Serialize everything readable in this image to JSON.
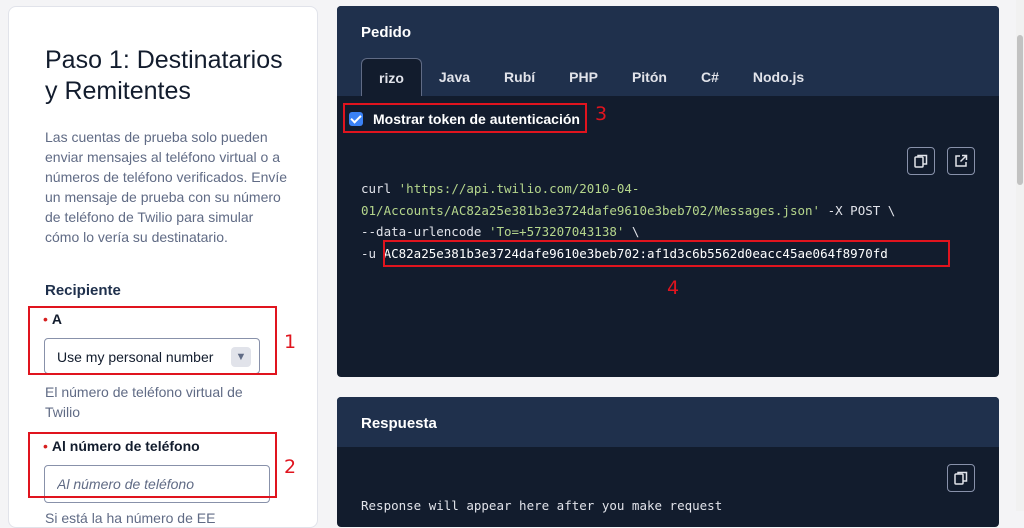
{
  "left": {
    "title": "Paso 1: Destinatarios y Remitentes",
    "description": "Las cuentas de prueba solo pueden enviar mensajes al teléfono virtual o a números de teléfono verificados. Envíe un mensaje de prueba con su número de teléfono de Twilio para simular cómo lo vería su destinatario.",
    "section_heading": "Recipiente",
    "to_field": {
      "required_mark": "•",
      "label": "A",
      "selected": "Use my personal number",
      "helper": "El número de teléfono virtual de Twilio"
    },
    "phone_field": {
      "required_mark": "•",
      "label": "Al número de teléfono",
      "placeholder": "Al número de teléfono",
      "cut_text": "Si está la ha número de EE"
    }
  },
  "annotations": [
    "1",
    "2",
    "3",
    "4"
  ],
  "request": {
    "title": "Pedido",
    "tabs": [
      "rizo",
      "Java",
      "Rubí",
      "PHP",
      "Pitón",
      "C#",
      "Nodo.js"
    ],
    "active_tab": "rizo",
    "show_token_label": "Mostrar token de autenticación",
    "show_token_checked": true,
    "code": {
      "l1_cmd": "curl ",
      "l1_str": "'https://api.twilio.com/2010-04-",
      "l2_str": "01/Accounts/AC82a25e381b3e3724dafe9610e3beb702/Messages.json'",
      "l2_rest": " -X POST \\",
      "l3_cmd": "--data-urlencode ",
      "l3_str": "'To=+573207043138'",
      "l3_rest": " \\",
      "l4_cmd": "-u ",
      "l4_token": "AC82a25e381b3e3724dafe9610e3beb702:af1d3c6b5562d0eacc45ae064f8970fd"
    }
  },
  "response": {
    "title": "Respuesta",
    "placeholder": "Response will appear here after you make request"
  },
  "icons": {
    "copy": "copy-icon",
    "open": "external-link-icon",
    "checkbox": "checkbox-checked-icon",
    "caret": "chevron-down-icon"
  },
  "colors": {
    "panel_bg": "#121c2d",
    "panel_header": "#1f304c",
    "accent": "#3b82f6",
    "annotation": "#e0141e",
    "string": "#b5d68c"
  }
}
